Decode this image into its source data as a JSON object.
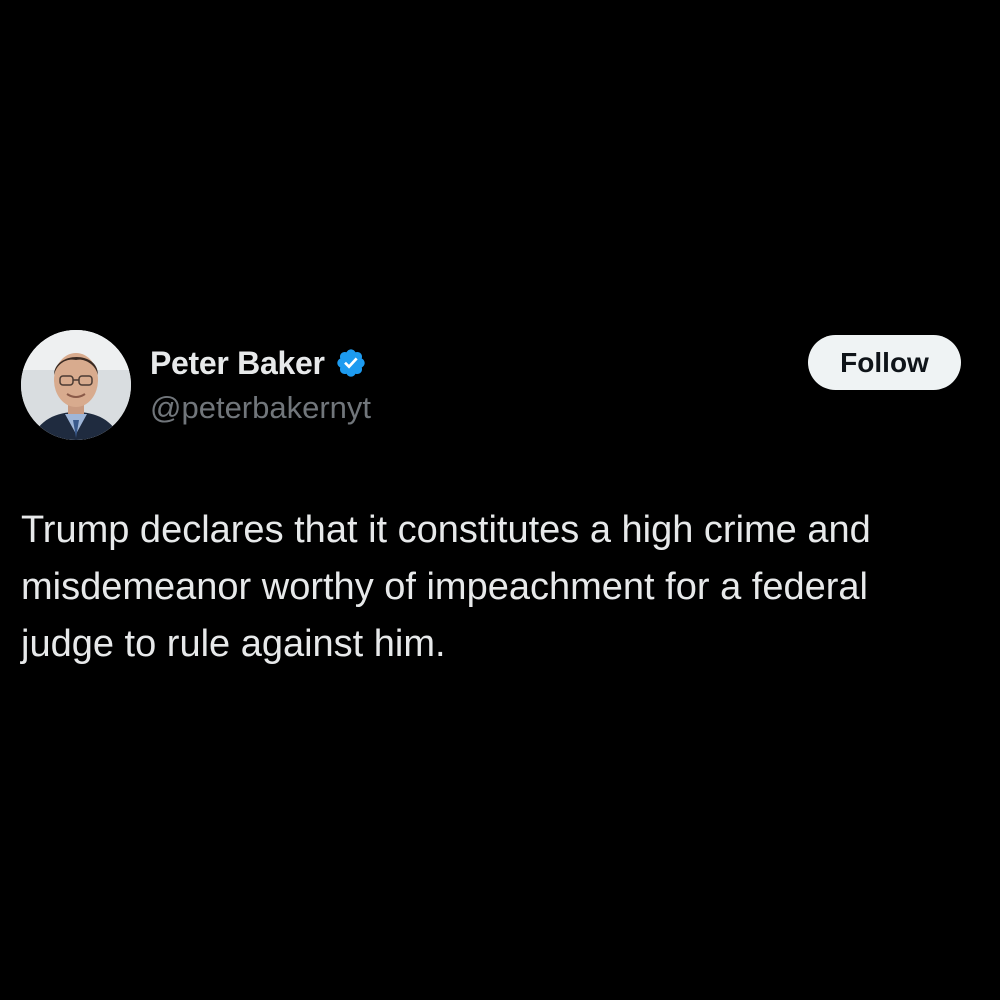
{
  "colors": {
    "background": "#000000",
    "primary_text": "#e7e9ea",
    "secondary_text": "#71767b",
    "verified_badge": "#1d9bf0",
    "follow_button_bg": "#eff3f4",
    "follow_button_text": "#0f1419"
  },
  "author": {
    "display_name": "Peter Baker",
    "handle": "@peterbakernyt",
    "verified": true,
    "avatar_icon": "profile-photo",
    "badge_icon": "verified-badge-icon"
  },
  "actions": {
    "follow_label": "Follow"
  },
  "post": {
    "text_lines": [
      "Trump declares that it constitutes a high crime and",
      "misdemeanor worthy of impeachment for a federal",
      "judge to rule against him."
    ]
  }
}
